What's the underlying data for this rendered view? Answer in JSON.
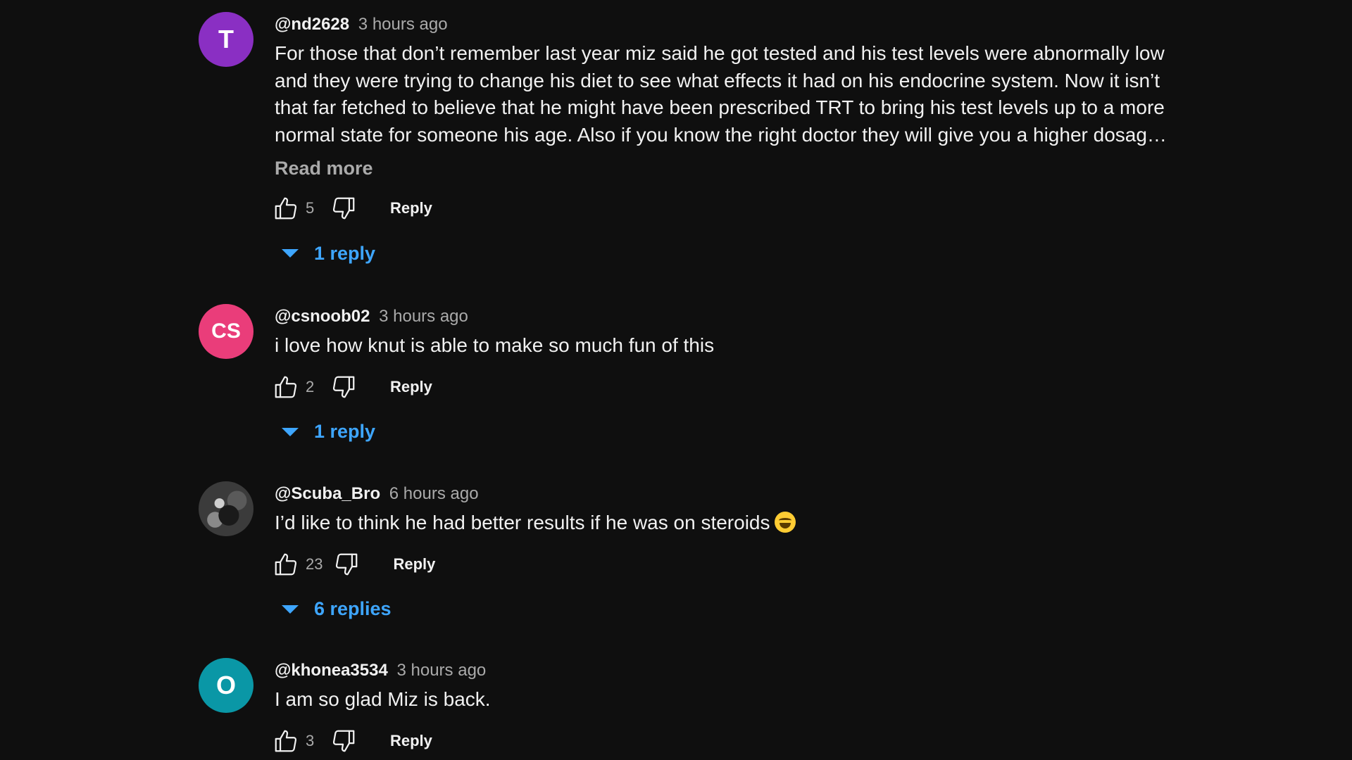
{
  "comments": [
    {
      "avatar_letter": "T",
      "avatar_color": "#8a2fc3",
      "author": "@nd2628",
      "time": "3 hours ago",
      "text": "For those that don’t remember last year miz said he got tested and his test levels were abnormally low and they were trying to change his diet to see what effects it had on his endocrine system. Now it isn’t that far fetched to believe that he might have been prescribed TRT to bring his test levels up to a more normal state for someone his age. Also if you know the right doctor they will give you a higher dosag…",
      "read_more": "Read more",
      "likes": "5",
      "reply_label": "Reply",
      "replies_label": "1 reply"
    },
    {
      "avatar_letter": "CS",
      "avatar_color": "#ea3d7a",
      "author": "@csnoob02",
      "time": "3 hours ago",
      "text": "i love how knut is able to make so much fun of this",
      "likes": "2",
      "reply_label": "Reply",
      "replies_label": "1 reply"
    },
    {
      "avatar_letter": "",
      "avatar_color": "#3b3b3b",
      "author": "@Scuba_Bro",
      "time": "6 hours ago",
      "text": "I’d like to think he had better results if he was on steroids",
      "emoji": "laughing-emoji",
      "likes": "23",
      "reply_label": "Reply",
      "replies_label": "6 replies"
    },
    {
      "avatar_letter": "O",
      "avatar_color": "#0a97a6",
      "author": "@khonea3534",
      "time": "3 hours ago",
      "text": "I am so glad Miz is back.",
      "likes": "3",
      "reply_label": "Reply"
    }
  ],
  "icons": {
    "like": "thumbs-up-icon",
    "dislike": "thumbs-down-icon",
    "expand": "caret-down-icon"
  },
  "colors": {
    "background": "#0f0f0f",
    "link_blue": "#3ea6ff",
    "secondary_text": "#aaaaaa"
  }
}
